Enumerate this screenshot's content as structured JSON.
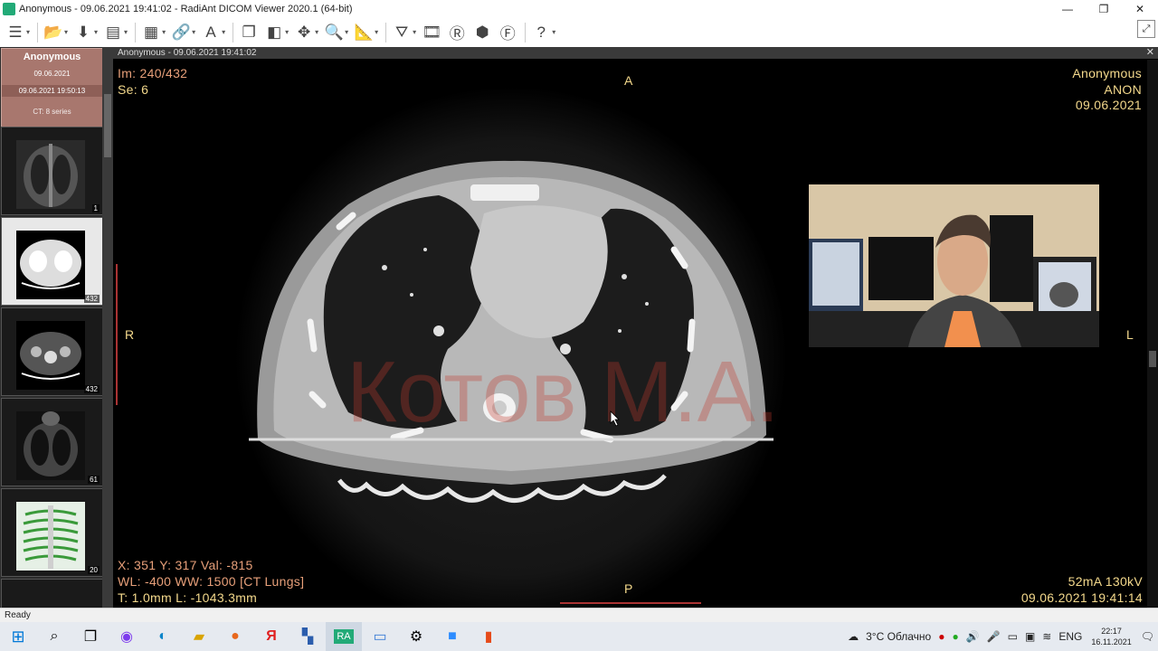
{
  "window": {
    "title": "Anonymous - 09.06.2021 19:41:02 - RadiAnt DICOM Viewer 2020.1 (64-bit)",
    "minimize": "—",
    "maximize": "❐",
    "close": "✕"
  },
  "toolbar": {
    "items": [
      "menu-icon",
      "open-icon",
      "download-icon",
      "save-icon",
      "layout-icon",
      "link-icon",
      "annotation-text-icon",
      "series-icon",
      "window-level-icon",
      "pan-icon",
      "zoom-icon",
      "measure-icon",
      "mpr-icon",
      "film-icon",
      "reset-icon",
      "3d-icon",
      "fusion-icon",
      "help-icon"
    ]
  },
  "sidebar": {
    "study": {
      "patient": "Anonymous",
      "date": "09.06.2021",
      "datetime": "09.06.2021 19:50:13",
      "modality": "CT: 8 series"
    },
    "series": [
      {
        "count": "1"
      },
      {
        "count": "432"
      },
      {
        "count": "432"
      },
      {
        "count": "61"
      },
      {
        "count": "20"
      }
    ]
  },
  "viewer": {
    "header": "Anonymous - 09.06.2021 19:41:02",
    "close": "✕",
    "top_left": {
      "image": "Im: 240/432",
      "series": "Se: 6"
    },
    "top_right": {
      "name": "Anonymous",
      "id": "ANON",
      "date": "09.06.2021"
    },
    "orientation": {
      "top": "A",
      "bottom": "P",
      "left": "R",
      "right": "L"
    },
    "bottom_left": {
      "coords": "X: 351 Y: 317 Val: -815",
      "window": "WL: -400 WW: 1500 [CT Lungs]",
      "thickness": "T: 1.0mm L: -1043.3mm"
    },
    "bottom_right": {
      "params": "52mA 130kV",
      "datetime": "09.06.2021 19:41:14"
    },
    "watermark": "Котов М.А."
  },
  "status": {
    "text": "Ready"
  },
  "taskbar": {
    "weather": "3°C  Облачно",
    "lang": "ENG",
    "time": "22:17",
    "date": "16.11.2021"
  },
  "colors": {
    "overlay": "#f4d98c",
    "overlay_red": "#e8a07a",
    "selected_study": "#a8776e"
  }
}
